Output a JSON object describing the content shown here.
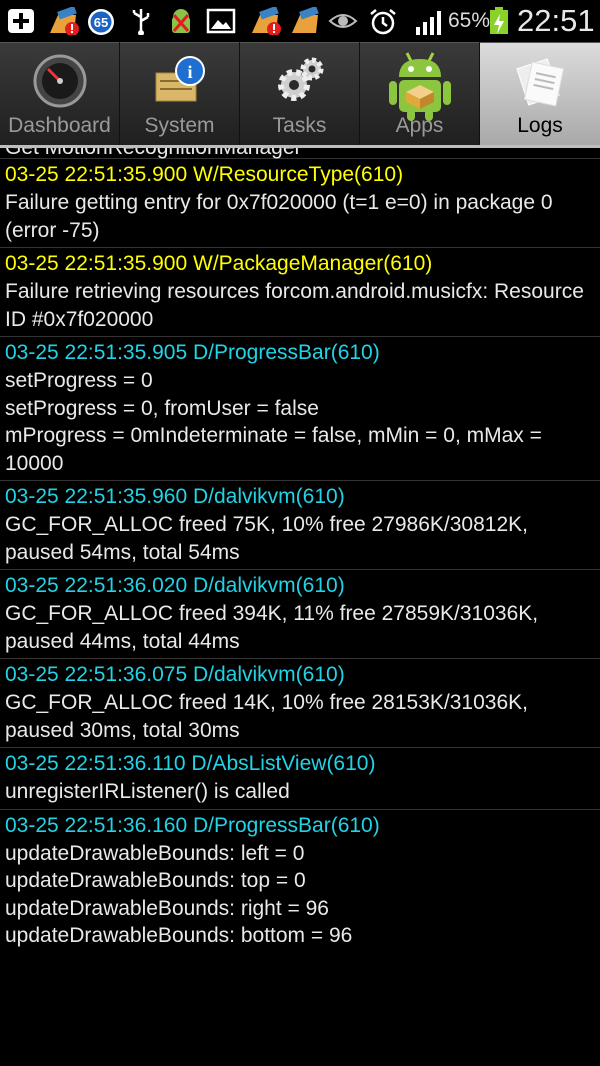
{
  "status_bar": {
    "icons": [
      "add-icon",
      "cleaner-broom-alert-icon",
      "badge-65-icon",
      "usb-icon",
      "android-debug-icon",
      "gallery-icon",
      "cleaner-broom-alert-icon",
      "cleaner-broom-icon",
      "eye-icon",
      "alarm-icon",
      "signal-icon"
    ],
    "badge": "65",
    "battery_percent": "65%",
    "time": "22:51"
  },
  "tabs": [
    {
      "label": "Dashboard",
      "icon": "speedometer-icon",
      "selected": false
    },
    {
      "label": "System",
      "icon": "system-info-icon",
      "selected": false
    },
    {
      "label": "Tasks",
      "icon": "gears-icon",
      "selected": false
    },
    {
      "label": "Apps",
      "icon": "android-apps-icon",
      "selected": false
    },
    {
      "label": "Logs",
      "icon": "logs-papers-icon",
      "selected": true
    }
  ],
  "log": {
    "partial_line": "Get MotionRecognitionManager",
    "entries": [
      {
        "level": "warn",
        "header": "03-25 22:51:35.900 W/ResourceType(610)",
        "lines": [
          "Failure getting entry for 0x7f020000 (t=1 e=0) in package 0 (error -75)"
        ]
      },
      {
        "level": "warn",
        "header": "03-25 22:51:35.900 W/PackageManager(610)",
        "lines": [
          "Failure retrieving resources forcom.android.musicfx: Resource ID #0x7f020000"
        ]
      },
      {
        "level": "debug",
        "header": "03-25 22:51:35.905 D/ProgressBar(610)",
        "lines": [
          "setProgress = 0",
          "setProgress = 0, fromUser = false",
          "mProgress = 0mIndeterminate = false, mMin = 0, mMax = 10000"
        ]
      },
      {
        "level": "debug",
        "header": "03-25 22:51:35.960 D/dalvikvm(610)",
        "lines": [
          "GC_FOR_ALLOC freed 75K, 10% free 27986K/30812K, paused 54ms, total 54ms"
        ]
      },
      {
        "level": "debug",
        "header": "03-25 22:51:36.020 D/dalvikvm(610)",
        "lines": [
          "GC_FOR_ALLOC freed 394K, 11% free 27859K/31036K, paused 44ms, total 44ms"
        ]
      },
      {
        "level": "debug",
        "header": "03-25 22:51:36.075 D/dalvikvm(610)",
        "lines": [
          "GC_FOR_ALLOC freed 14K, 10% free 28153K/31036K, paused 30ms, total 30ms"
        ]
      },
      {
        "level": "debug",
        "header": "03-25 22:51:36.110 D/AbsListView(610)",
        "lines": [
          "unregisterIRListener() is called"
        ]
      },
      {
        "level": "debug",
        "header": "03-25 22:51:36.160 D/ProgressBar(610)",
        "lines": [
          "updateDrawableBounds: left = 0",
          "updateDrawableBounds: top = 0",
          "updateDrawableBounds: right = 96",
          "updateDrawableBounds: bottom = 96"
        ]
      }
    ]
  }
}
